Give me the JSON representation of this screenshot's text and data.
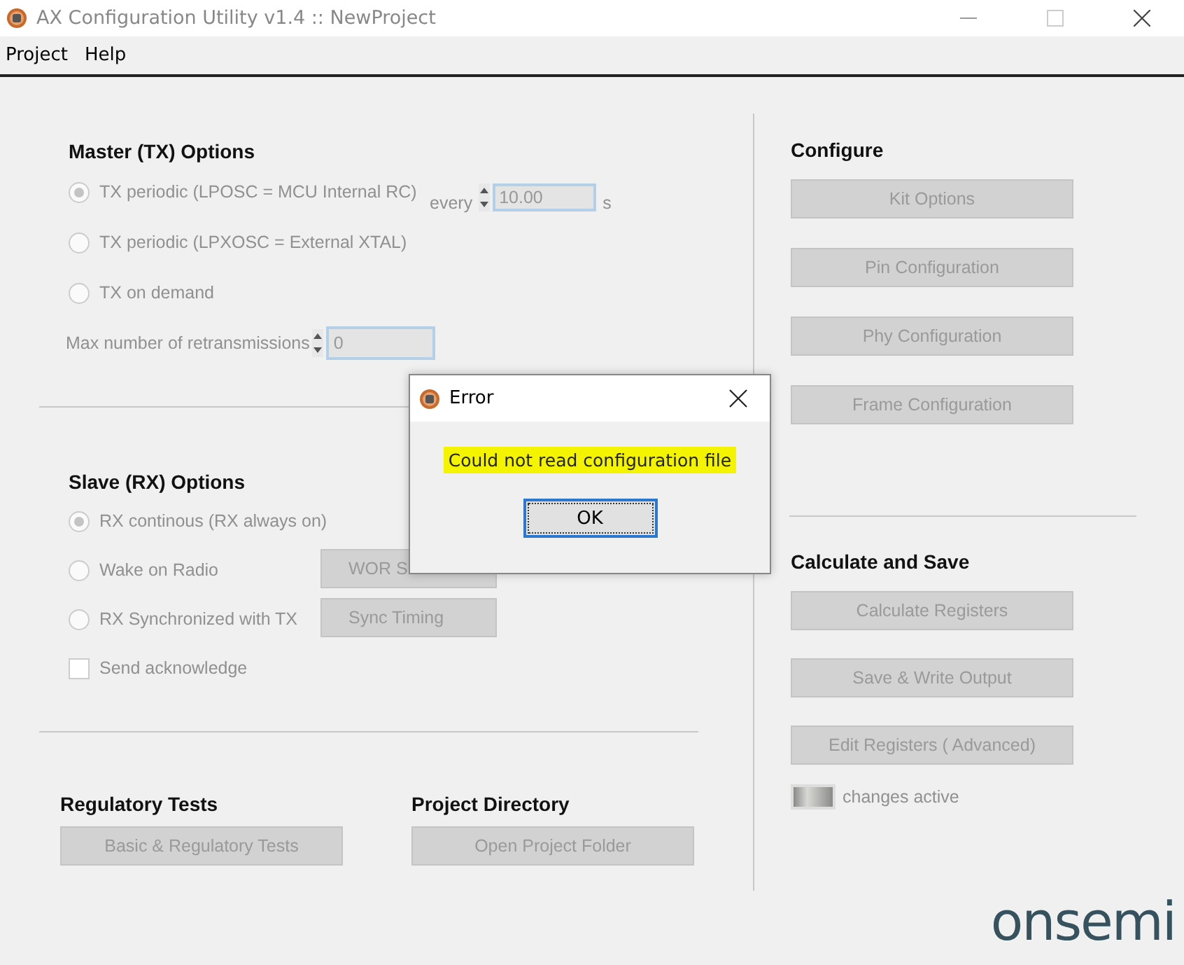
{
  "window": {
    "title": "AX Configuration Utility v1.4 :: NewProject"
  },
  "menu": [
    "Project",
    "Help"
  ],
  "master": {
    "heading": "Master (TX) Options",
    "options": [
      {
        "label": "TX periodic (LPOSC = MCU Internal RC)",
        "selected": true,
        "disabled": true
      },
      {
        "label": "TX periodic (LPXOSC = External XTAL)",
        "selected": false,
        "disabled": true
      },
      {
        "label": "TX on demand",
        "selected": false,
        "disabled": true
      }
    ],
    "period": {
      "label": "every",
      "value": "10.00",
      "unit": "s"
    },
    "retransmissions": {
      "label": "Max number of retransmissions",
      "value": "0"
    }
  },
  "slave": {
    "heading": "Slave (RX) Options",
    "options": [
      {
        "label": "RX continous (RX always on)",
        "selected": true,
        "disabled": true
      },
      {
        "label": "Wake on Radio",
        "selected": false,
        "disabled": true,
        "button": "WOR S"
      },
      {
        "label": "RX Synchronized with TX",
        "selected": false,
        "disabled": true,
        "button": "Sync Timing"
      }
    ],
    "acknowledge": {
      "label": "Send acknowledge",
      "checked": false,
      "disabled": true
    }
  },
  "regulatory": {
    "heading": "Regulatory Tests",
    "button": {
      "label": "Basic & Regulatory Tests",
      "disabled": true
    }
  },
  "project_directory": {
    "heading": "Project Directory",
    "button": {
      "label": "Open Project Folder",
      "disabled": true
    }
  },
  "configure": {
    "heading": "Configure",
    "buttons": [
      {
        "label": "Kit Options",
        "disabled": true
      },
      {
        "label": "Pin Configuration",
        "disabled": true
      },
      {
        "label": "Phy Configuration",
        "disabled": true
      },
      {
        "label": "Frame Configuration",
        "disabled": true
      }
    ]
  },
  "calculate": {
    "heading": "Calculate and Save",
    "buttons": [
      {
        "label": "Calculate Registers",
        "disabled": true
      },
      {
        "label": "Save & Write Output",
        "disabled": true
      },
      {
        "label": "Edit Registers ( Advanced)",
        "disabled": true
      }
    ]
  },
  "indicator": {
    "label": "changes active",
    "on": false
  },
  "logo": "onsemi",
  "dialog": {
    "title": "Error",
    "message": "Could not read configuration file",
    "button": "OK"
  }
}
